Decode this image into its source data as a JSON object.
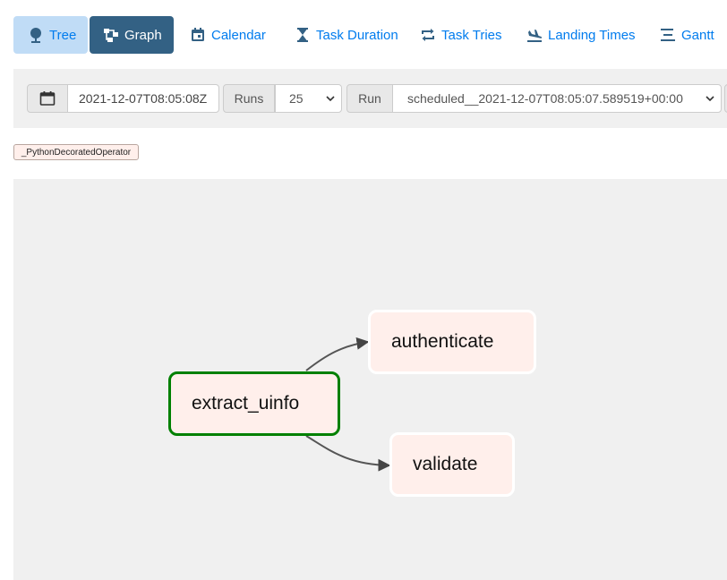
{
  "nav": {
    "tabs": [
      {
        "label": "Tree",
        "icon": "tree-icon"
      },
      {
        "label": "Graph",
        "icon": "graph-icon"
      },
      {
        "label": "Calendar",
        "icon": "calendar-icon"
      },
      {
        "label": "Task Duration",
        "icon": "hourglass-icon"
      },
      {
        "label": "Task Tries",
        "icon": "repeat-icon"
      },
      {
        "label": "Landing Times",
        "icon": "plane-landing-icon"
      },
      {
        "label": "Gantt",
        "icon": "gantt-icon"
      }
    ],
    "active_tab": "Graph"
  },
  "controls": {
    "date_value": "2021-12-07T08:05:08Z",
    "runs_label": "Runs",
    "runs_value": "25",
    "run_label": "Run",
    "run_value": "scheduled__2021-12-07T08:05:07.589519+00:00"
  },
  "legend": {
    "operator_label": "_PythonDecoratedOperator"
  },
  "graph": {
    "nodes": [
      {
        "id": "extract_uinfo",
        "label": "extract_uinfo",
        "state": "success"
      },
      {
        "id": "authenticate",
        "label": "authenticate"
      },
      {
        "id": "validate",
        "label": "validate"
      }
    ],
    "edges": [
      {
        "from": "extract_uinfo",
        "to": "authenticate"
      },
      {
        "from": "extract_uinfo",
        "to": "validate"
      }
    ]
  },
  "colors": {
    "accent": "#017cee",
    "active_tab_bg": "#336184",
    "tree_tab_bg": "#c0dcf6",
    "node_fill": "#ffefeb",
    "success_border": "#008000",
    "panel_bg": "#f0f0f0"
  }
}
